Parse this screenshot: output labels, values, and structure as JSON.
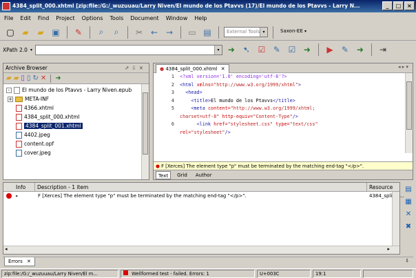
{
  "window": {
    "title": "4384_split_000.xhtml [zip:file:/G:/_wuzuuau/Larry Niven/El mundo de los Ptavvs (17)/El mundo de los Ptavvs - Larry N...",
    "buttons": [
      "_",
      "□",
      "×"
    ]
  },
  "menu": [
    "File",
    "Edit",
    "Find",
    "Project",
    "Options",
    "Tools",
    "Document",
    "Window",
    "Help"
  ],
  "toolbar": {
    "external_tools": "External Tools",
    "saxon": "Saxon-EE"
  },
  "xpath": {
    "label": "XPath 2.0",
    "value": ""
  },
  "archive_browser": {
    "title": "Archive Browser",
    "items": [
      {
        "label": "El mundo de los Ptavvs - Larry Niven.epub",
        "type": "archive",
        "indent": 0
      },
      {
        "label": "META-INF",
        "type": "folder",
        "indent": 0
      },
      {
        "label": "4366.xhtml",
        "type": "file",
        "indent": 1
      },
      {
        "label": "4384_split_000.xhtml",
        "type": "file",
        "indent": 1
      },
      {
        "label": "4384_split_001.xhtml",
        "type": "file",
        "indent": 1,
        "selected": true
      },
      {
        "label": "4402.jpeg",
        "type": "file",
        "indent": 1
      },
      {
        "label": "content.opf",
        "type": "file",
        "indent": 1
      },
      {
        "label": "cover.jpeg",
        "type": "file",
        "indent": 1
      }
    ]
  },
  "editor": {
    "tab": "4384_split_000.xhtml",
    "lines": [
      {
        "n": "1",
        "html": "<span class='pi'>&lt;?xml version='1.0' encoding='utf-8'?&gt;</span>"
      },
      {
        "n": "2",
        "html": "<span class='tag'>&lt;html</span> <span class='attr'>xmlns=</span><span class='val'>\"http://www.w3.org/1999/xhtml\"</span><span class='tag'>&gt;</span>"
      },
      {
        "n": "3",
        "html": "&nbsp;&nbsp;<span class='tag'>&lt;head&gt;</span>"
      },
      {
        "n": "4",
        "html": "&nbsp;&nbsp;&nbsp;&nbsp;<span class='tag'>&lt;title&gt;</span>El mundo de los Ptavvs<span class='tag'>&lt;/title&gt;</span>"
      },
      {
        "n": "5",
        "html": "&nbsp;&nbsp;&nbsp;&nbsp;<span class='tag'>&lt;meta</span> <span class='attr'>content=</span><span class='val'>\"http://www.w3.org/1999/xhtml;</span>"
      },
      {
        "n": "",
        "html": "<span class='val'>charset=utf-8\"</span> <span class='attr'>http-equiv=</span><span class='val'>\"Content-Type\"</span><span class='tag'>/&gt;</span>"
      },
      {
        "n": "6",
        "html": "&nbsp;&nbsp;&nbsp;&nbsp;&nbsp;&nbsp;<span class='tag'>&lt;link</span> <span class='attr'>href=</span><span class='val'>\"stylesheet.css\"</span> <span class='attr'>type=</span><span class='val'>\"text/css\"</span>"
      },
      {
        "n": "",
        "html": "<span class='attr'>rel=</span><span class='val'>\"stylesheet\"</span><span class='tag'>/&gt;</span>"
      }
    ],
    "error": "F [Xerces] The element type \"p\" must be terminated by the matching end-tag \"</p>\".",
    "modes": [
      "Text",
      "Grid",
      "Author"
    ]
  },
  "results": {
    "col_info": "Info",
    "col_description": "Description - 1 item",
    "col_resource": "Resource",
    "rows": [
      {
        "description": "F [Xerces] The element type \"p\" must be terminated by the matching end-tag \"</p>\".",
        "resource": "4384_split_0..."
      }
    ]
  },
  "errors_tab": "Errors",
  "status": {
    "path": "zip:file:/G:/_wuzuuau/Larry Niven/El m...",
    "validation": "Wellformed test - failed. Errors: 1",
    "encoding": "U+003C",
    "position": "19:1"
  }
}
